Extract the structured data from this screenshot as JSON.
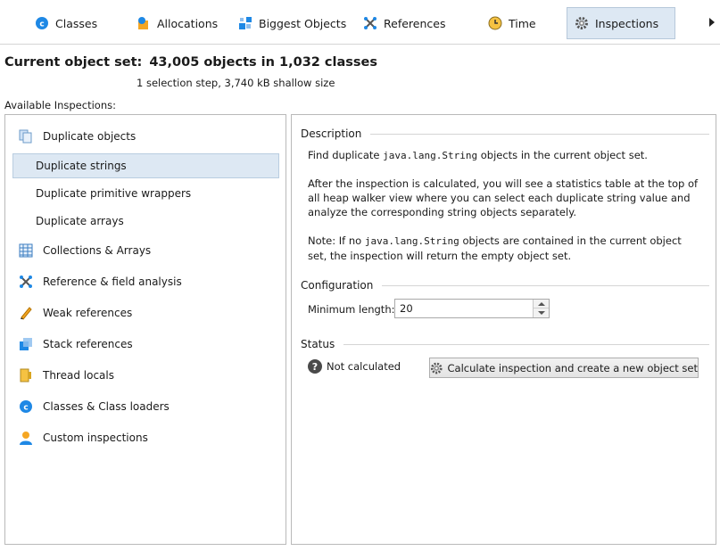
{
  "tabs": [
    {
      "label": "Classes",
      "icon": "class-icon"
    },
    {
      "label": "Allocations",
      "icon": "allocations-icon"
    },
    {
      "label": "Biggest Objects",
      "icon": "biggest-objects-icon"
    },
    {
      "label": "References",
      "icon": "references-icon"
    },
    {
      "label": "Time",
      "icon": "clock-icon"
    },
    {
      "label": "Inspections",
      "icon": "gear-icon",
      "active": true
    }
  ],
  "header": {
    "title_prefix": "Current object set:",
    "title_value": "43,005 objects in 1,032 classes",
    "subtitle": "1 selection step, 3,740 kB shallow size"
  },
  "inspections_label": "Available Inspections:",
  "inspections": [
    {
      "label": "Duplicate objects",
      "icon": "duplicate-objects-icon"
    },
    {
      "label": "Duplicate strings",
      "selected": true
    },
    {
      "label": "Duplicate primitive wrappers"
    },
    {
      "label": "Duplicate arrays"
    },
    {
      "label": "Collections & Arrays",
      "icon": "collections-icon"
    },
    {
      "label": "Reference & field analysis",
      "icon": "reference-analysis-icon"
    },
    {
      "label": "Weak references",
      "icon": "weak-references-icon"
    },
    {
      "label": "Stack references",
      "icon": "stack-references-icon"
    },
    {
      "label": "Thread locals",
      "icon": "thread-locals-icon"
    },
    {
      "label": "Classes & Class loaders",
      "icon": "class-icon"
    },
    {
      "label": "Custom inspections",
      "icon": "user-icon"
    }
  ],
  "description": {
    "heading": "Description",
    "p1_pre": "Find duplicate ",
    "p1_code": "java.lang.String",
    "p1_post": " objects in the current object set.",
    "p2": "After the inspection is calculated, you will see a statistics table at the top of all heap walker view where you can select each duplicate string value and analyze the corresponding string objects separately.",
    "p3_pre": "Note: If no ",
    "p3_code": "java.lang.String",
    "p3_post": " objects are contained in the current object set, the inspection will return the empty object set."
  },
  "configuration": {
    "heading": "Configuration",
    "min_length_label": "Minimum length:",
    "min_length_value": "20"
  },
  "status": {
    "heading": "Status",
    "text": "Not calculated",
    "button_label": "Calculate inspection and create a new object set"
  },
  "colors": {
    "accent_blue": "#1e88e5",
    "selection_bg": "#dde8f3"
  }
}
